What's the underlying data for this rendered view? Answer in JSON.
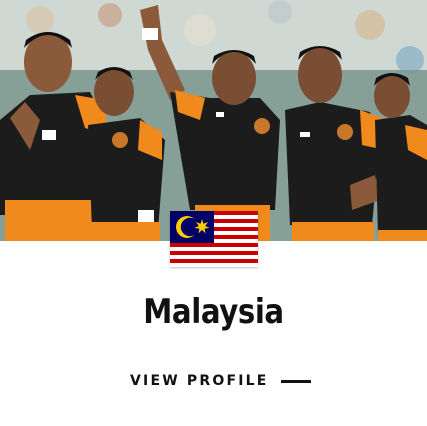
{
  "team": {
    "country": "Malaysia",
    "flag_icon": "malaysia-flag-icon"
  },
  "actions": {
    "view_profile_label": "VIEW PROFILE",
    "arrow_icon": "line-arrow-icon"
  },
  "colors": {
    "text": "#111111",
    "jersey_black": "#1c1c1c",
    "jersey_orange": "#f08a1c",
    "flag_red": "#cc0001",
    "flag_blue": "#010066",
    "flag_yellow": "#ffcc00"
  }
}
